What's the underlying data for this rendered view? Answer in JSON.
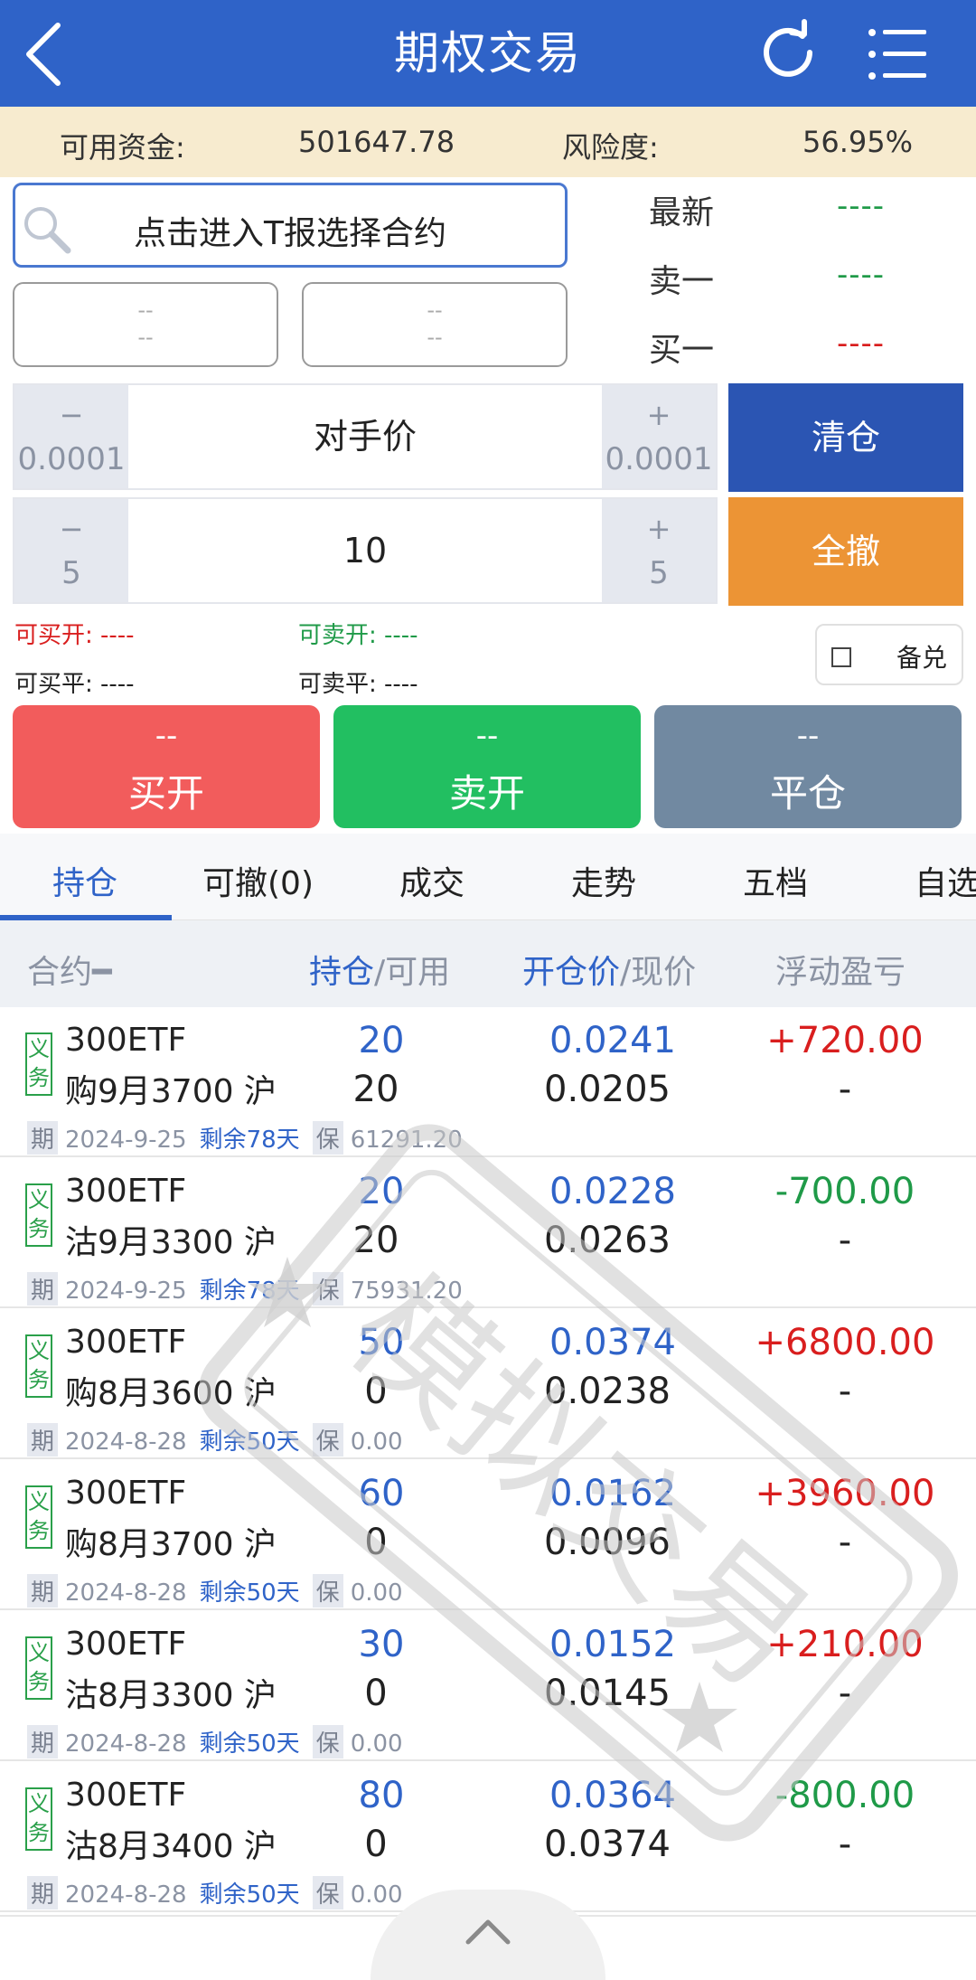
{
  "header": {
    "title": "期权交易"
  },
  "funds": {
    "label1": "可用资金:",
    "value1": "501647.78",
    "label2": "风险度:",
    "value2": "56.95%"
  },
  "contract": {
    "search_text": "点击进入T报选择合约",
    "box_left": [
      "--",
      "--"
    ],
    "box_right": [
      "--",
      "--"
    ]
  },
  "quote": [
    {
      "label": "最新",
      "value": "----",
      "color": "#1f9a48"
    },
    {
      "label": "卖一",
      "value": "----",
      "color": "#1f9a48"
    },
    {
      "label": "买一",
      "value": "----",
      "color": "#d91e1e"
    }
  ],
  "price_stepper": {
    "minus": "−",
    "minus_val": "0.0001",
    "center": "对手价",
    "plus": "+",
    "plus_val": "0.0001"
  },
  "qty_stepper": {
    "minus": "−",
    "minus_val": "5",
    "center": "10",
    "plus": "+",
    "plus_val": "5"
  },
  "buttons": {
    "clear": "清仓",
    "cancel_all": "全撤"
  },
  "avail": {
    "buy_open": "可买开: ----",
    "sell_open": "可卖开: ----",
    "buy_close": "可买平: ----",
    "sell_close": "可卖平: ----"
  },
  "covered": {
    "label": "备兑"
  },
  "actions": [
    {
      "top": "--",
      "label": "买开",
      "color": "#f25c5c"
    },
    {
      "top": "--",
      "label": "卖开",
      "color": "#22bf61"
    },
    {
      "top": "--",
      "label": "平仓",
      "color": "#7189a1"
    }
  ],
  "tabs": [
    "持仓",
    "可撤(0)",
    "成交",
    "走势",
    "五档",
    "自选"
  ],
  "table_header": {
    "contract": "合约━",
    "hold": "持仓",
    "hold_sep": "/可用",
    "open_price": "开仓价",
    "open_sep": "/现价",
    "pnl": "浮动盈亏"
  },
  "rows": [
    {
      "tag": "义务",
      "name1": "300ETF",
      "name2": "购9月3700 沪",
      "hold": "20",
      "avail": "20",
      "open": "0.0241",
      "now": "0.0205",
      "pnl": "+720.00",
      "pnl_sign": "pos",
      "pnl2": "-",
      "date": "2024-9-25",
      "remain": "剩余78天",
      "margin": "61291.20"
    },
    {
      "tag": "义务",
      "name1": "300ETF",
      "name2": "沽9月3300 沪",
      "hold": "20",
      "avail": "20",
      "open": "0.0228",
      "now": "0.0263",
      "pnl": "-700.00",
      "pnl_sign": "neg",
      "pnl2": "-",
      "date": "2024-9-25",
      "remain": "剩余78天",
      "margin": "75931.20"
    },
    {
      "tag": "义务",
      "name1": "300ETF",
      "name2": "购8月3600 沪",
      "hold": "50",
      "avail": "0",
      "open": "0.0374",
      "now": "0.0238",
      "pnl": "+6800.00",
      "pnl_sign": "pos",
      "pnl2": "-",
      "date": "2024-8-28",
      "remain": "剩余50天",
      "margin": "0.00"
    },
    {
      "tag": "义务",
      "name1": "300ETF",
      "name2": "购8月3700 沪",
      "hold": "60",
      "avail": "0",
      "open": "0.0162",
      "now": "0.0096",
      "pnl": "+3960.00",
      "pnl_sign": "pos",
      "pnl2": "-",
      "date": "2024-8-28",
      "remain": "剩余50天",
      "margin": "0.00"
    },
    {
      "tag": "义务",
      "name1": "300ETF",
      "name2": "沽8月3300 沪",
      "hold": "30",
      "avail": "0",
      "open": "0.0152",
      "now": "0.0145",
      "pnl": "+210.00",
      "pnl_sign": "pos",
      "pnl2": "-",
      "date": "2024-8-28",
      "remain": "剩余50天",
      "margin": "0.00"
    },
    {
      "tag": "义务",
      "name1": "300ETF",
      "name2": "沽8月3400 沪",
      "hold": "80",
      "avail": "0",
      "open": "0.0364",
      "now": "0.0374",
      "pnl": "-800.00",
      "pnl_sign": "neg",
      "pnl2": "-",
      "date": "2024-8-28",
      "remain": "剩余50天",
      "margin": "0.00"
    }
  ],
  "row_meta_labels": {
    "period": "期",
    "margin": "保"
  },
  "watermark": {
    "text": "模拟交易"
  },
  "icons": {
    "back": "back-chevron-icon",
    "refresh": "refresh-icon",
    "menu": "list-menu-icon",
    "search": "search-icon",
    "expand": "chevron-up-icon"
  }
}
